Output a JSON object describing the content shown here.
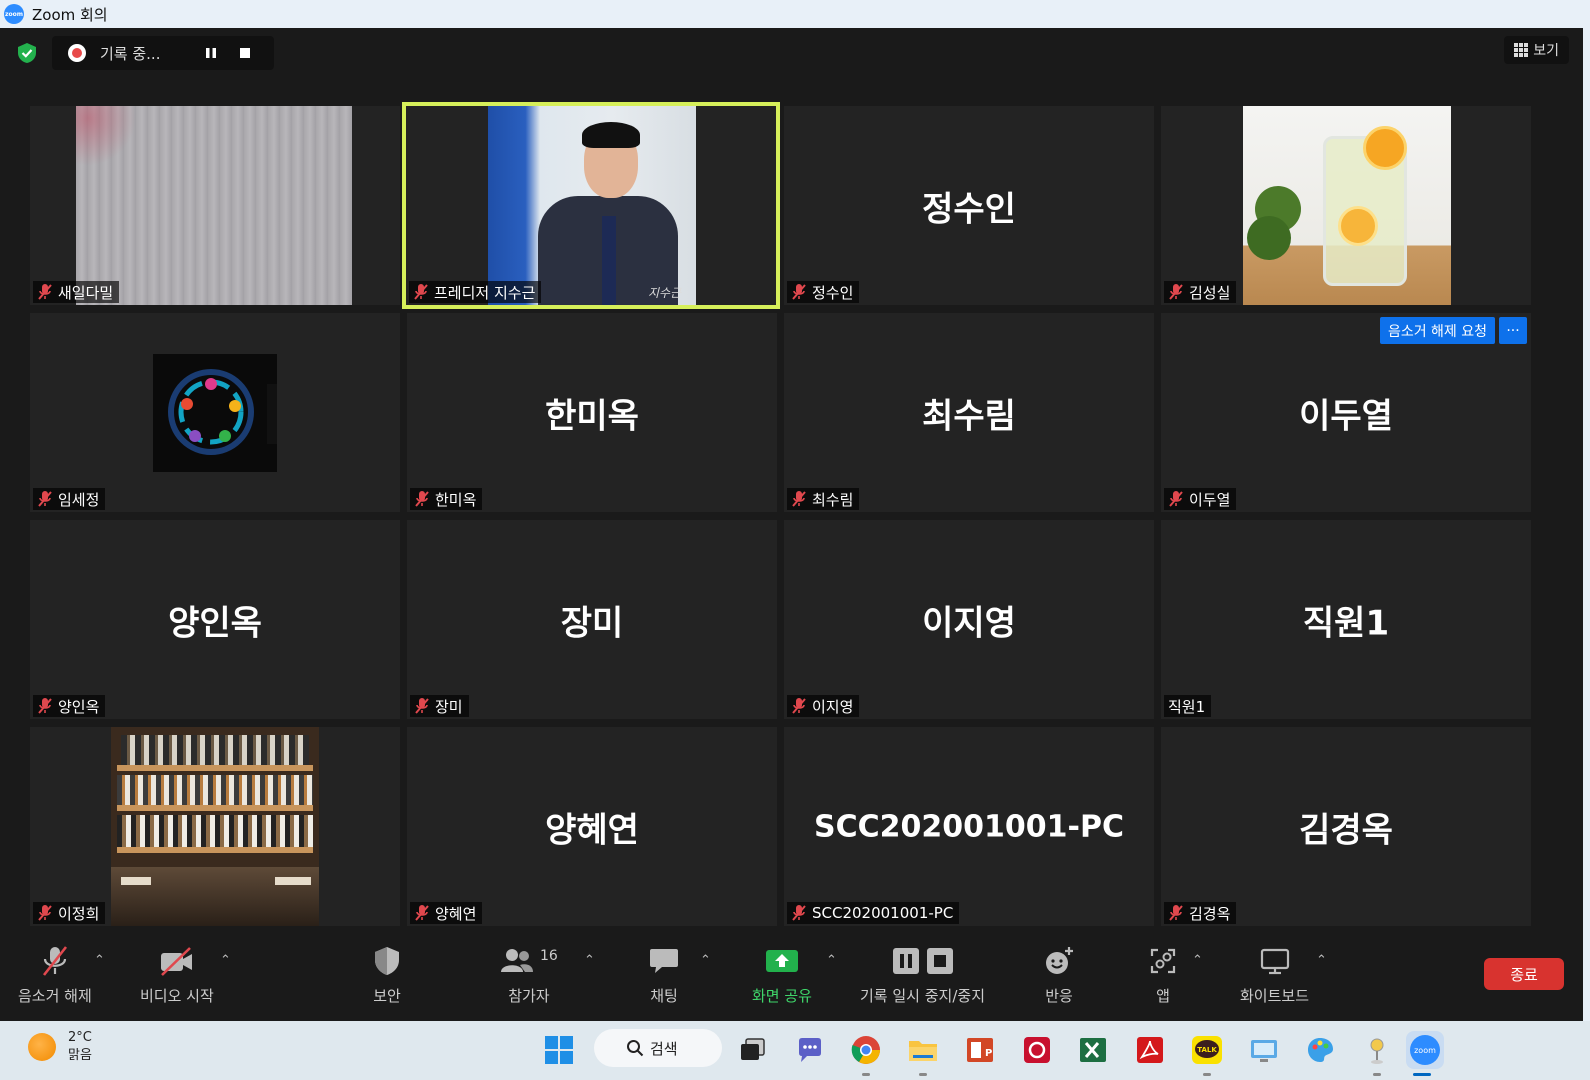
{
  "window": {
    "title": "Zoom 회의"
  },
  "topbar": {
    "recording_status": "기록 중...",
    "view_label": "보기"
  },
  "tiles": [
    {
      "name": "새일다밀",
      "display": ""
    },
    {
      "name": "프레디저 지수근",
      "display": ""
    },
    {
      "name": "정수인",
      "display": "정수인"
    },
    {
      "name": "김성실",
      "display": ""
    },
    {
      "name": "임세정",
      "display": ""
    },
    {
      "name": "한미옥",
      "display": "한미옥"
    },
    {
      "name": "최수림",
      "display": "최수림"
    },
    {
      "name": "이두열",
      "display": "이두열"
    },
    {
      "name": "양인옥",
      "display": "양인옥"
    },
    {
      "name": "장미",
      "display": "장미"
    },
    {
      "name": "이지영",
      "display": "이지영"
    },
    {
      "name": "직원1",
      "display": "직원1"
    },
    {
      "name": "이정희",
      "display": ""
    },
    {
      "name": "양혜연",
      "display": "양혜연"
    },
    {
      "name": "SCC202001001-PC",
      "display": "SCC202001001-PC"
    },
    {
      "name": "김경옥",
      "display": "김경옥"
    }
  ],
  "tile_actions": {
    "unmute_request": "음소거 해제 요청",
    "more": "···"
  },
  "photo_caption": "지수근",
  "toolbar": {
    "unmute": "음소거 해제",
    "start_video": "비디오 시작",
    "security": "보안",
    "participants": "참가자",
    "participant_count": "16",
    "chat": "채팅",
    "share_screen": "화면 공유",
    "pause_stop_recording": "기록 일시 중지/중지",
    "reactions": "반응",
    "apps": "앱",
    "whiteboard": "화이트보드",
    "end": "종료"
  },
  "taskbar": {
    "temperature": "2°C",
    "condition": "맑음",
    "search": "검색",
    "talk_icon_text": "TALK",
    "zoom_icon_text": "zoom"
  },
  "colors": {
    "accent_blue": "#0e71eb",
    "active_speaker": "#d6ef5a",
    "end_red": "#d8332f",
    "share_green": "#3fd66a",
    "muted_red": "#e0484e"
  }
}
